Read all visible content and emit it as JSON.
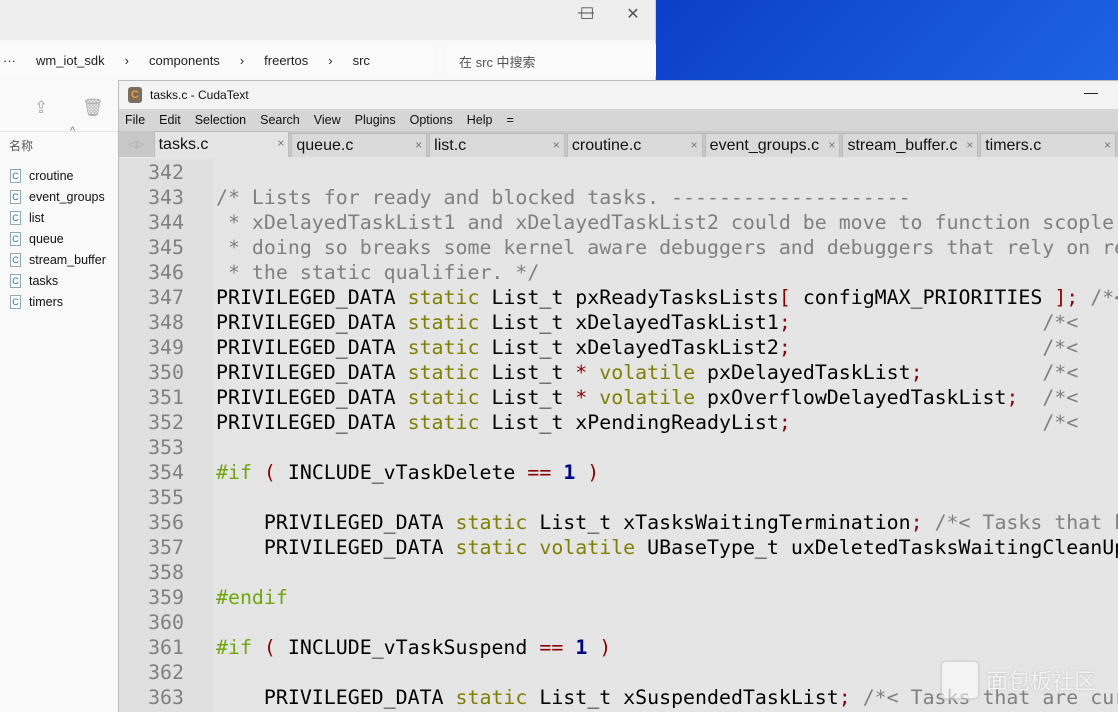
{
  "explorer": {
    "window_controls": [
      "—",
      "☐",
      "✕"
    ],
    "breadcrumb": {
      "overflow": "···",
      "items": [
        "wm_iot_sdk",
        "components",
        "freertos",
        "src"
      ],
      "separator": "›"
    },
    "search_placeholder": "在 src 中搜索",
    "column_header": "名称",
    "sort_arrow": "^",
    "files": [
      "croutine",
      "event_groups",
      "list",
      "queue",
      "stream_buffer",
      "tasks",
      "timers"
    ],
    "file_icon_letter": "C"
  },
  "editor": {
    "title": "tasks.c - CudaText",
    "logo_letter": "C",
    "minimize": "—",
    "menu": [
      "File",
      "Edit",
      "Selection",
      "Search",
      "View",
      "Plugins",
      "Options",
      "Help",
      "="
    ],
    "tabs": [
      {
        "label": "tasks.c",
        "active": true
      },
      {
        "label": "queue.c"
      },
      {
        "label": "list.c"
      },
      {
        "label": "croutine.c"
      },
      {
        "label": "event_groups.c"
      },
      {
        "label": "stream_buffer.c"
      },
      {
        "label": "timers.c"
      }
    ],
    "tab_close": "×",
    "tab_arrows": "◁▷",
    "colors": {
      "comment": "#808080",
      "keyword": "#808000",
      "preprocessor": "#6fa80b",
      "number": "#00008b",
      "operator": "#8b0000"
    },
    "lines": [
      {
        "n": "342",
        "tokens": []
      },
      {
        "n": "343",
        "tokens": [
          [
            "comment",
            "/* Lists for ready and blocked tasks. --------------------"
          ]
        ]
      },
      {
        "n": "344",
        "tokens": [
          [
            "comment",
            " * xDelayedTaskList1 and xDelayedTaskList2 could be move to function scople"
          ]
        ]
      },
      {
        "n": "345",
        "tokens": [
          [
            "comment",
            " * doing so breaks some kernel aware debuggers and debuggers that rely on re"
          ]
        ]
      },
      {
        "n": "346",
        "tokens": [
          [
            "comment",
            " * the static qualifier. */"
          ]
        ]
      },
      {
        "n": "347",
        "tokens": [
          [
            "text",
            "PRIVILEGED_DATA "
          ],
          [
            "kw",
            "static"
          ],
          [
            "text",
            " List_t pxReadyTasksLists"
          ],
          [
            "op",
            "["
          ],
          [
            "text",
            " configMAX_PRIORITIES "
          ],
          [
            "op",
            "];"
          ],
          [
            "text",
            " "
          ],
          [
            "comment",
            "/*<"
          ]
        ]
      },
      {
        "n": "348",
        "tokens": [
          [
            "text",
            "PRIVILEGED_DATA "
          ],
          [
            "kw",
            "static"
          ],
          [
            "text",
            " List_t xDelayedTaskList1"
          ],
          [
            "op",
            ";"
          ],
          [
            "text",
            "                     "
          ],
          [
            "comment",
            "/*<"
          ]
        ]
      },
      {
        "n": "349",
        "tokens": [
          [
            "text",
            "PRIVILEGED_DATA "
          ],
          [
            "kw",
            "static"
          ],
          [
            "text",
            " List_t xDelayedTaskList2"
          ],
          [
            "op",
            ";"
          ],
          [
            "text",
            "                     "
          ],
          [
            "comment",
            "/*<"
          ]
        ]
      },
      {
        "n": "350",
        "tokens": [
          [
            "text",
            "PRIVILEGED_DATA "
          ],
          [
            "kw",
            "static"
          ],
          [
            "text",
            " List_t "
          ],
          [
            "op",
            "*"
          ],
          [
            "text",
            " "
          ],
          [
            "kw",
            "volatile"
          ],
          [
            "text",
            " pxDelayedTaskList"
          ],
          [
            "op",
            ";"
          ],
          [
            "text",
            "          "
          ],
          [
            "comment",
            "/*<"
          ]
        ]
      },
      {
        "n": "351",
        "tokens": [
          [
            "text",
            "PRIVILEGED_DATA "
          ],
          [
            "kw",
            "static"
          ],
          [
            "text",
            " List_t "
          ],
          [
            "op",
            "*"
          ],
          [
            "text",
            " "
          ],
          [
            "kw",
            "volatile"
          ],
          [
            "text",
            " pxOverflowDelayedTaskList"
          ],
          [
            "op",
            ";"
          ],
          [
            "text",
            "  "
          ],
          [
            "comment",
            "/*<"
          ]
        ]
      },
      {
        "n": "352",
        "tokens": [
          [
            "text",
            "PRIVILEGED_DATA "
          ],
          [
            "kw",
            "static"
          ],
          [
            "text",
            " List_t xPendingReadyList"
          ],
          [
            "op",
            ";"
          ],
          [
            "text",
            "                     "
          ],
          [
            "comment",
            "/*<"
          ]
        ]
      },
      {
        "n": "353",
        "tokens": []
      },
      {
        "n": "354",
        "tokens": [
          [
            "pp",
            "#if"
          ],
          [
            "text",
            " "
          ],
          [
            "op",
            "("
          ],
          [
            "text",
            " INCLUDE_vTaskDelete "
          ],
          [
            "op",
            "=="
          ],
          [
            "text",
            " "
          ],
          [
            "num",
            "1"
          ],
          [
            "text",
            " "
          ],
          [
            "op",
            ")"
          ]
        ]
      },
      {
        "n": "355",
        "tokens": []
      },
      {
        "n": "356",
        "tokens": [
          [
            "text",
            "    PRIVILEGED_DATA "
          ],
          [
            "kw",
            "static"
          ],
          [
            "text",
            " List_t xTasksWaitingTermination"
          ],
          [
            "op",
            ";"
          ],
          [
            "text",
            " "
          ],
          [
            "comment",
            "/*< Tasks that h"
          ]
        ]
      },
      {
        "n": "357",
        "tokens": [
          [
            "text",
            "    PRIVILEGED_DATA "
          ],
          [
            "kw",
            "static"
          ],
          [
            "text",
            " "
          ],
          [
            "kw",
            "volatile"
          ],
          [
            "text",
            " UBaseType_t uxDeletedTasksWaitingCleanUp"
          ]
        ]
      },
      {
        "n": "358",
        "tokens": []
      },
      {
        "n": "359",
        "tokens": [
          [
            "pp",
            "#endif"
          ]
        ]
      },
      {
        "n": "360",
        "tokens": []
      },
      {
        "n": "361",
        "tokens": [
          [
            "pp",
            "#if"
          ],
          [
            "text",
            " "
          ],
          [
            "op",
            "("
          ],
          [
            "text",
            " INCLUDE_vTaskSuspend "
          ],
          [
            "op",
            "=="
          ],
          [
            "text",
            " "
          ],
          [
            "num",
            "1"
          ],
          [
            "text",
            " "
          ],
          [
            "op",
            ")"
          ]
        ]
      },
      {
        "n": "362",
        "tokens": []
      },
      {
        "n": "363",
        "tokens": [
          [
            "text",
            "    PRIVILEGED_DATA "
          ],
          [
            "kw",
            "static"
          ],
          [
            "text",
            " List_t xSuspendedTaskList"
          ],
          [
            "op",
            ";"
          ],
          [
            "text",
            " "
          ],
          [
            "comment",
            "/*< Tasks that are cur"
          ]
        ]
      }
    ]
  },
  "watermark": {
    "text": "面包板社区"
  }
}
